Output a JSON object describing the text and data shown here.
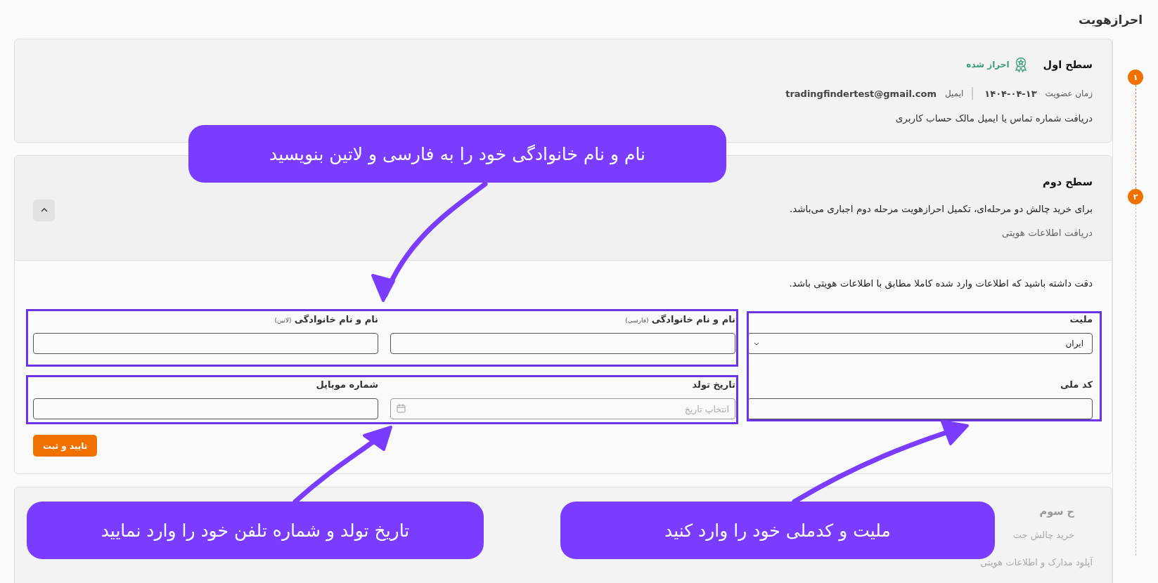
{
  "page_title": "احرازهویت",
  "steps": [
    {
      "number": "۱"
    },
    {
      "number": "۲"
    }
  ],
  "levels": [
    {
      "kind": "summary",
      "title": "سطح اول",
      "status": "احراز شده",
      "meta": [
        {
          "label": "زمان عضویت",
          "value": "۱۴۰۴-۰۴-۱۳"
        },
        {
          "label": "ایمیل",
          "value": "tradingfindertest@gmail.com"
        }
      ],
      "description": "دریافت شماره تماس یا ایمیل مالک حساب کاربری"
    },
    {
      "kind": "form",
      "title": "سطح دوم",
      "expanded": true,
      "notice": "برای خرید چالش دو مرحله‌ای، تکمیل احرازهویت مرحله دوم اجباری می‌باشد.",
      "description": "دریافت اطلاعات هویتی",
      "form": {
        "warning": "دقت داشته باشید که اطلاعات وارد شده کاملا مطابق با اطلاعات هویتی باشد.",
        "fields": [
          {
            "kind": "select",
            "label": "ملیت",
            "value": "ایران"
          },
          {
            "kind": "text",
            "label": "نام و نام خانوادگی",
            "hint": "(فارسی)"
          },
          {
            "kind": "text",
            "label": "نام و نام خانوادگی",
            "hint": "(لاتین)"
          },
          {
            "kind": "text",
            "label": "کد ملی"
          },
          {
            "kind": "date",
            "label": "تاریخ تولد",
            "placeholder": "انتخاب تاریخ"
          },
          {
            "kind": "text",
            "label": "شماره موبایل"
          }
        ],
        "submit": "تایید و ثبت"
      }
    },
    {
      "kind": "locked",
      "title": "ح سوم",
      "lines": [
        "خرید چالش جت",
        "آپلود مدارک و اطلاعات هویتی"
      ]
    }
  ],
  "callouts": [
    {
      "text": "نام و نام خانوادگی خود را به فارسی و لاتین بنویسید"
    },
    {
      "text": "ملیت و کدملی خود را وارد کنید"
    },
    {
      "text": "تاریخ تولد و شماره تلفن خود را وارد نمایید"
    }
  ]
}
